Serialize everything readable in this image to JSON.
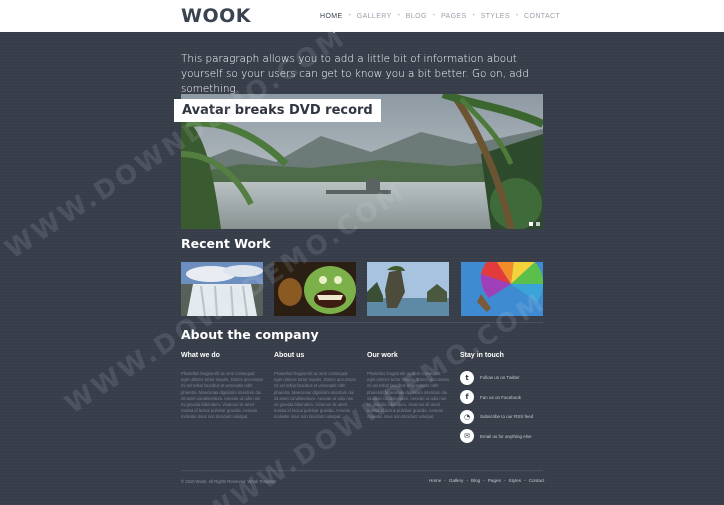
{
  "header": {
    "logo": "WOOK",
    "nav": [
      {
        "label": "HOME",
        "active": true
      },
      {
        "label": "GALLERY",
        "active": false
      },
      {
        "label": "BLOG",
        "active": false
      },
      {
        "label": "PAGES",
        "active": false
      },
      {
        "label": "STYLES",
        "active": false
      },
      {
        "label": "CONTACT",
        "active": false
      }
    ]
  },
  "intro": {
    "text": "This paragraph allows you to add a little bit of information about yourself so your users can get to know you a bit better. Go on, add something."
  },
  "slider": {
    "caption": "Avatar breaks DVD record",
    "slide_count": 2,
    "active_slide": 1
  },
  "recent_work": {
    "title": "Recent Work",
    "items": [
      {
        "icon": "waterfall-photo"
      },
      {
        "icon": "green-monster-photo"
      },
      {
        "icon": "rock-island-photo"
      },
      {
        "icon": "hot-air-balloon-photo"
      }
    ]
  },
  "about": {
    "title": "About the company",
    "columns": [
      {
        "title": "What we do",
        "text": "Phasellus feugiat elit ac sem consequat eget ultrices tortor mauris. Donec accumsan mi vel tellus faucibus et venenatis nibh pharetra. Maecenas dignissim interdum dui sit amet condimentum. Aenean ut odio non mi gravida bibendum. Vivamus sit amet massa id lectus pulvinar gravida. Aenean molestie risus non tincidunt volutpat."
      },
      {
        "title": "About us",
        "text": "Phasellus feugiat elit ac sem consequat eget ultrices tortor mauris. Donec accumsan mi vel tellus faucibus et venenatis nibh pharetra. Maecenas dignissim interdum dui sit amet condimentum. Aenean ut odio non mi gravida bibendum. Vivamus sit amet massa id lectus pulvinar gravida. Aenean molestie risus non tincidunt volutpat."
      },
      {
        "title": "Our work",
        "text": "Phasellus feugiat elit ac sem consequat eget ultrices tortor mauris. Donec accumsan mi vel tellus faucibus et venenatis nibh pharetra. Maecenas dignissim interdum dui sit amet condimentum. Aenean ut odio non mi gravida bibendum. Vivamus sit amet massa id lectus pulvinar gravida. Aenean molestie risus non tincidunt volutpat."
      }
    ],
    "stay_in_touch": {
      "title": "Stay in touch",
      "links": [
        {
          "icon": "twitter-icon",
          "glyph": "t",
          "label": "Follow us on Twitter"
        },
        {
          "icon": "facebook-icon",
          "glyph": "f",
          "label": "Fan us on Facebook"
        },
        {
          "icon": "rss-icon",
          "glyph": "◔",
          "label": "Subscribe to our RSS feed"
        },
        {
          "icon": "email-icon",
          "glyph": "✉",
          "label": "Email us for anything else"
        }
      ]
    }
  },
  "footer": {
    "copyright": "© 2010 Wook. All Rights Reserved. Wook Template",
    "links": [
      "Home",
      "Gallery",
      "Blog",
      "Pages",
      "Styles",
      "Contact"
    ]
  },
  "watermark": "WWW.DOWNDEMO.COM"
}
